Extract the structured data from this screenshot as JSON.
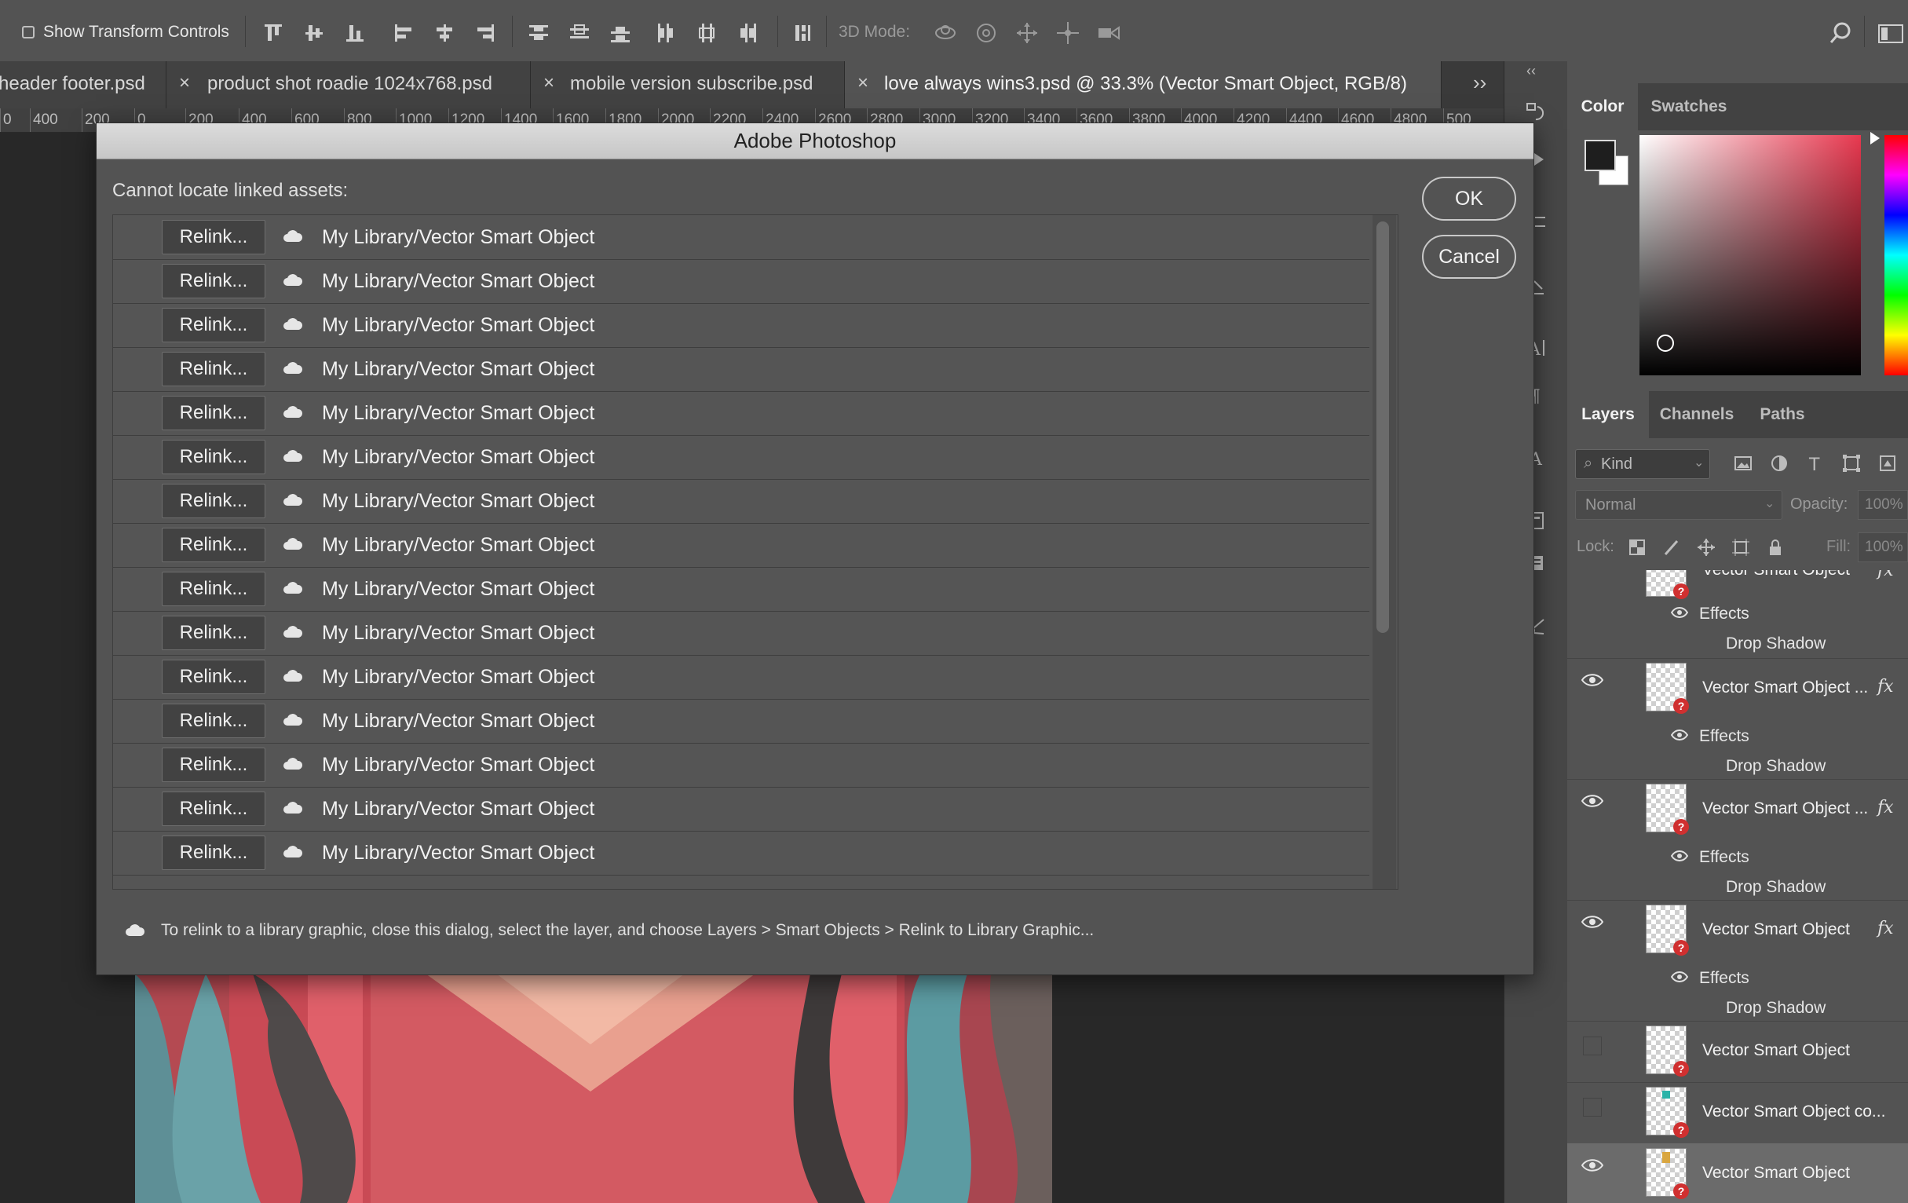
{
  "options_bar": {
    "show_transform_controls": "Show Transform Controls",
    "mode_3d_label": "3D Mode:",
    "search_icon": "search-icon",
    "workspace_icon": "workspace-icon"
  },
  "tabs": [
    {
      "label": "header footer.psd",
      "close": "×"
    },
    {
      "label": "product shot roadie 1024x768.psd",
      "close": "×"
    },
    {
      "label": "mobile version subscribe.psd",
      "close": "×"
    },
    {
      "label": "love always wins3.psd @ 33.3% (Vector Smart Object, RGB/8)",
      "close": "×"
    }
  ],
  "tabs_overflow": "››",
  "ruler_labels": [
    "0",
    "400",
    "200",
    "0",
    "200",
    "400",
    "600",
    "800",
    "1000",
    "1200",
    "1400",
    "1600",
    "1800",
    "2000",
    "2200",
    "2400",
    "2600",
    "2800",
    "3000",
    "3200",
    "3400",
    "3600",
    "3800",
    "4000",
    "4200",
    "4400",
    "4600",
    "4800",
    "500"
  ],
  "dialog": {
    "title": "Adobe Photoshop",
    "message": "Cannot locate linked assets:",
    "ok_label": "OK",
    "cancel_label": "Cancel",
    "relink_label": "Relink...",
    "items": [
      "My Library/Vector Smart Object",
      "My Library/Vector Smart Object",
      "My Library/Vector Smart Object",
      "My Library/Vector Smart Object",
      "My Library/Vector Smart Object",
      "My Library/Vector Smart Object",
      "My Library/Vector Smart Object",
      "My Library/Vector Smart Object",
      "My Library/Vector Smart Object",
      "My Library/Vector Smart Object",
      "My Library/Vector Smart Object",
      "My Library/Vector Smart Object",
      "My Library/Vector Smart Object",
      "My Library/Vector Smart Object",
      "My Library/Vector Smart Object"
    ],
    "footnote": "To relink to a library graphic, close this dialog, select the layer, and choose Layers > Smart Objects > Relink to Library Graphic..."
  },
  "color_panel": {
    "tabs": [
      "Color",
      "Swatches"
    ],
    "active_tab": "Color"
  },
  "layers_panel": {
    "tabs": [
      "Layers",
      "Channels",
      "Paths"
    ],
    "active_tab": "Layers",
    "filter_placeholder": "Kind",
    "blend_mode": "Normal",
    "opacity_label": "Opacity:",
    "opacity_value": "100%",
    "lock_label": "Lock:",
    "fill_label": "Fill:",
    "fill_value": "100%",
    "top_partial_name": "Vector Smart Object",
    "effects_label": "Effects",
    "drop_shadow_label": "Drop Shadow",
    "fx_symbol": "fx",
    "layers": [
      {
        "name": "Vector Smart Object ...",
        "visible": true,
        "fx": true
      },
      {
        "name": "Vector Smart Object ...",
        "visible": true,
        "fx": true
      },
      {
        "name": "Vector Smart Object",
        "visible": true,
        "fx": true
      },
      {
        "name": "Vector Smart Object",
        "visible": false,
        "fx": false
      },
      {
        "name": "Vector Smart Object co...",
        "visible": false,
        "fx": false
      },
      {
        "name": "Vector Smart Object",
        "visible": true,
        "fx": false
      }
    ]
  },
  "colors": {
    "foreground": "#1e1e1e",
    "background": "#ffffff",
    "accent_red": "#e8384f"
  }
}
